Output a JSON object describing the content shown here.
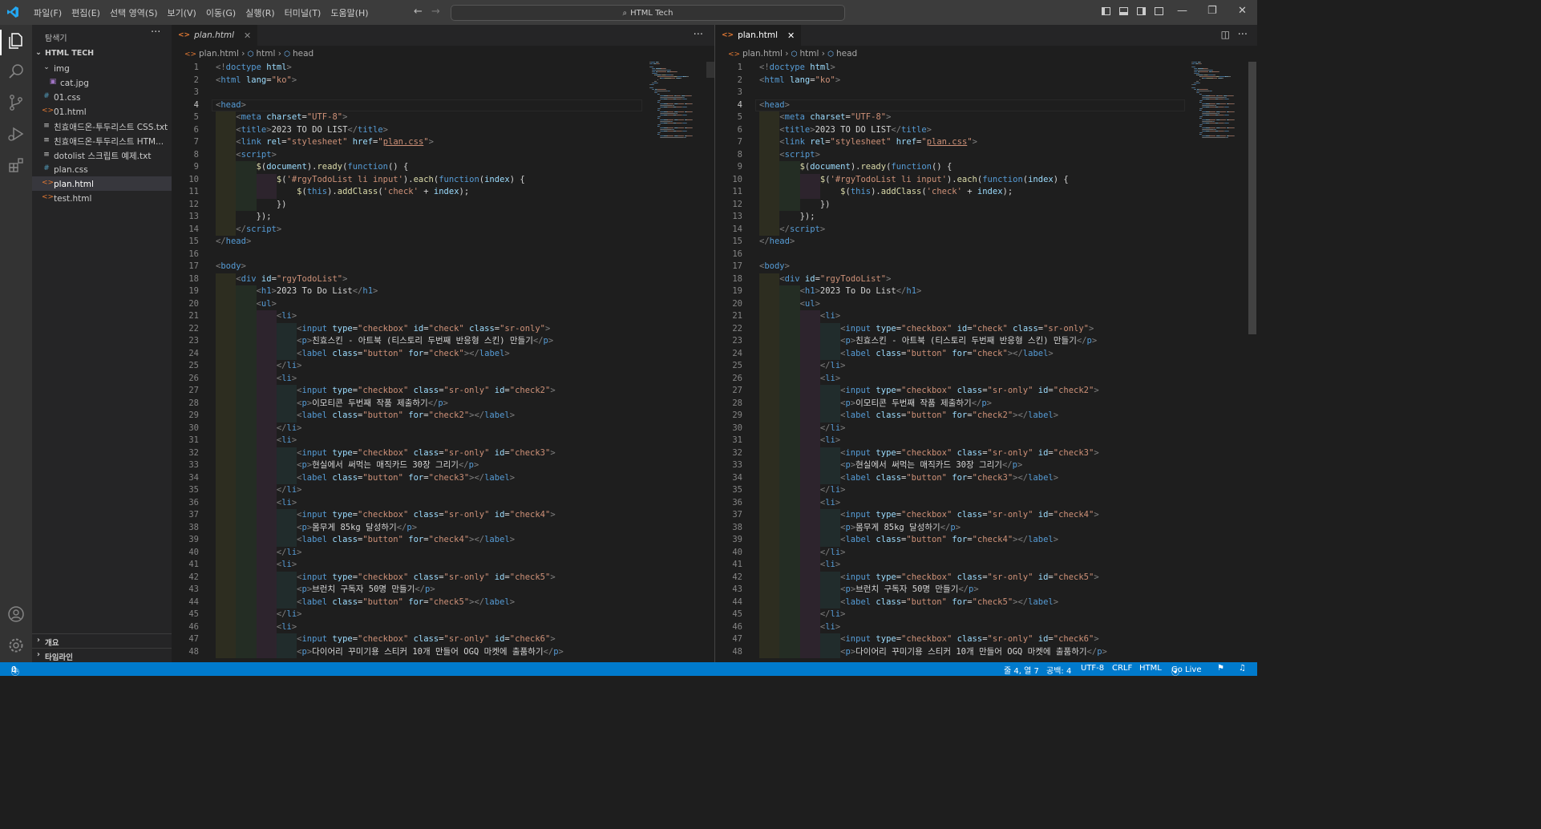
{
  "menus": [
    "파일(F)",
    "편집(E)",
    "선택 영역(S)",
    "보기(V)",
    "이동(G)",
    "실행(R)",
    "터미널(T)",
    "도움말(H)"
  ],
  "command_center": "HTML Tech",
  "sidebar": {
    "title": "탐색기",
    "root": "HTML TECH",
    "items": [
      {
        "label": "img",
        "icon": "chevron-down-icon"
      },
      {
        "label": "cat.jpg",
        "icon": "image-file-icon"
      },
      {
        "label": "01.css",
        "icon": "css-file-icon"
      },
      {
        "label": "01.html",
        "icon": "html-file-icon"
      },
      {
        "label": "친효애드온-투두리스트 CSS.txt",
        "icon": "text-file-icon"
      },
      {
        "label": "친효애드온-투두리스트 HTM...",
        "icon": "text-file-icon"
      },
      {
        "label": "dotolist 스크립트 예제.txt",
        "icon": "text-file-icon"
      },
      {
        "label": "plan.css",
        "icon": "css-file-icon"
      },
      {
        "label": "plan.html",
        "icon": "html-file-icon"
      },
      {
        "label": "test.html",
        "icon": "html-file-icon"
      }
    ],
    "outline": "개요",
    "timeline": "타임라인"
  },
  "editor": {
    "tab_label": "plan.html",
    "breadcrumb": [
      "plan.html",
      "html",
      "head"
    ],
    "current_line": 4
  },
  "code_lines": [
    [
      [
        "br",
        "<!"
      ],
      [
        "tg",
        "doctype"
      ],
      [
        "tx",
        " "
      ],
      [
        "at",
        "html"
      ],
      [
        "br",
        ">"
      ]
    ],
    [
      [
        "br",
        "<"
      ],
      [
        "tg",
        "html"
      ],
      [
        "tx",
        " "
      ],
      [
        "at",
        "lang"
      ],
      [
        "tx",
        "="
      ],
      [
        "st",
        "\"ko\""
      ],
      [
        "br",
        ">"
      ]
    ],
    [],
    [
      [
        "br",
        "<"
      ],
      [
        "tg",
        "head"
      ],
      [
        "br",
        ">"
      ]
    ],
    [
      [
        "tx",
        "    "
      ],
      [
        "br",
        "<"
      ],
      [
        "tg",
        "meta"
      ],
      [
        "tx",
        " "
      ],
      [
        "at",
        "charset"
      ],
      [
        "tx",
        "="
      ],
      [
        "st",
        "\"UTF-8\""
      ],
      [
        "br",
        ">"
      ]
    ],
    [
      [
        "tx",
        "    "
      ],
      [
        "br",
        "<"
      ],
      [
        "tg",
        "title"
      ],
      [
        "br",
        ">"
      ],
      [
        "tx",
        "2023 TO DO LIST"
      ],
      [
        "br",
        "</"
      ],
      [
        "tg",
        "title"
      ],
      [
        "br",
        ">"
      ]
    ],
    [
      [
        "tx",
        "    "
      ],
      [
        "br",
        "<"
      ],
      [
        "tg",
        "link"
      ],
      [
        "tx",
        " "
      ],
      [
        "at",
        "rel"
      ],
      [
        "tx",
        "="
      ],
      [
        "st",
        "\"stylesheet\""
      ],
      [
        "tx",
        " "
      ],
      [
        "at",
        "href"
      ],
      [
        "tx",
        "="
      ],
      [
        "st",
        "\""
      ],
      [
        "stu",
        "plan.css"
      ],
      [
        "st",
        "\""
      ],
      [
        "br",
        ">"
      ]
    ],
    [
      [
        "tx",
        "    "
      ],
      [
        "br",
        "<"
      ],
      [
        "tg",
        "script"
      ],
      [
        "br",
        ">"
      ]
    ],
    [
      [
        "tx",
        "        "
      ],
      [
        "fn",
        "$"
      ],
      [
        "tx",
        "("
      ],
      [
        "at",
        "document"
      ],
      [
        "tx",
        ")."
      ],
      [
        "fn",
        "ready"
      ],
      [
        "tx",
        "("
      ],
      [
        "kw",
        "function"
      ],
      [
        "tx",
        "() {"
      ]
    ],
    [
      [
        "tx",
        "            "
      ],
      [
        "fn",
        "$"
      ],
      [
        "tx",
        "("
      ],
      [
        "st",
        "'#rgyTodoList li input'"
      ],
      [
        "tx",
        ")."
      ],
      [
        "fn",
        "each"
      ],
      [
        "tx",
        "("
      ],
      [
        "kw",
        "function"
      ],
      [
        "tx",
        "("
      ],
      [
        "at",
        "index"
      ],
      [
        "tx",
        ") {"
      ]
    ],
    [
      [
        "tx",
        "                "
      ],
      [
        "fn",
        "$"
      ],
      [
        "tx",
        "("
      ],
      [
        "kw",
        "this"
      ],
      [
        "tx",
        ")."
      ],
      [
        "fn",
        "addClass"
      ],
      [
        "tx",
        "("
      ],
      [
        "st",
        "'check'"
      ],
      [
        "tx",
        " + "
      ],
      [
        "at",
        "index"
      ],
      [
        "tx",
        ");"
      ]
    ],
    [
      [
        "tx",
        "            })"
      ]
    ],
    [
      [
        "tx",
        "        });"
      ]
    ],
    [
      [
        "tx",
        "    "
      ],
      [
        "br",
        "</"
      ],
      [
        "tg",
        "script"
      ],
      [
        "br",
        ">"
      ]
    ],
    [
      [
        "br",
        "</"
      ],
      [
        "tg",
        "head"
      ],
      [
        "br",
        ">"
      ]
    ],
    [],
    [
      [
        "br",
        "<"
      ],
      [
        "tg",
        "body"
      ],
      [
        "br",
        ">"
      ]
    ],
    [
      [
        "tx",
        "    "
      ],
      [
        "br",
        "<"
      ],
      [
        "tg",
        "div"
      ],
      [
        "tx",
        " "
      ],
      [
        "at",
        "id"
      ],
      [
        "tx",
        "="
      ],
      [
        "st",
        "\"rgyTodoList\""
      ],
      [
        "br",
        ">"
      ]
    ],
    [
      [
        "tx",
        "        "
      ],
      [
        "br",
        "<"
      ],
      [
        "tg",
        "h1"
      ],
      [
        "br",
        ">"
      ],
      [
        "tx",
        "2023 To Do List"
      ],
      [
        "br",
        "</"
      ],
      [
        "tg",
        "h1"
      ],
      [
        "br",
        ">"
      ]
    ],
    [
      [
        "tx",
        "        "
      ],
      [
        "br",
        "<"
      ],
      [
        "tg",
        "ul"
      ],
      [
        "br",
        ">"
      ]
    ],
    [
      [
        "tx",
        "            "
      ],
      [
        "br",
        "<"
      ],
      [
        "tg",
        "li"
      ],
      [
        "br",
        ">"
      ]
    ],
    [
      [
        "tx",
        "                "
      ],
      [
        "br",
        "<"
      ],
      [
        "tg",
        "input"
      ],
      [
        "tx",
        " "
      ],
      [
        "at",
        "type"
      ],
      [
        "tx",
        "="
      ],
      [
        "st",
        "\"checkbox\""
      ],
      [
        "tx",
        " "
      ],
      [
        "at",
        "id"
      ],
      [
        "tx",
        "="
      ],
      [
        "st",
        "\"check\""
      ],
      [
        "tx",
        " "
      ],
      [
        "at",
        "class"
      ],
      [
        "tx",
        "="
      ],
      [
        "st",
        "\"sr-only\""
      ],
      [
        "br",
        ">"
      ]
    ],
    [
      [
        "tx",
        "                "
      ],
      [
        "br",
        "<"
      ],
      [
        "tg",
        "p"
      ],
      [
        "br",
        ">"
      ],
      [
        "tx",
        "친효스킨 - 아트북 (티스토리 두번째 반응형 스킨) 만들기"
      ],
      [
        "br",
        "</"
      ],
      [
        "tg",
        "p"
      ],
      [
        "br",
        ">"
      ]
    ],
    [
      [
        "tx",
        "                "
      ],
      [
        "br",
        "<"
      ],
      [
        "tg",
        "label"
      ],
      [
        "tx",
        " "
      ],
      [
        "at",
        "class"
      ],
      [
        "tx",
        "="
      ],
      [
        "st",
        "\"button\""
      ],
      [
        "tx",
        " "
      ],
      [
        "at",
        "for"
      ],
      [
        "tx",
        "="
      ],
      [
        "st",
        "\"check\""
      ],
      [
        "br",
        "></"
      ],
      [
        "tg",
        "label"
      ],
      [
        "br",
        ">"
      ]
    ],
    [
      [
        "tx",
        "            "
      ],
      [
        "br",
        "</"
      ],
      [
        "tg",
        "li"
      ],
      [
        "br",
        ">"
      ]
    ],
    [
      [
        "tx",
        "            "
      ],
      [
        "br",
        "<"
      ],
      [
        "tg",
        "li"
      ],
      [
        "br",
        ">"
      ]
    ],
    [
      [
        "tx",
        "                "
      ],
      [
        "br",
        "<"
      ],
      [
        "tg",
        "input"
      ],
      [
        "tx",
        " "
      ],
      [
        "at",
        "type"
      ],
      [
        "tx",
        "="
      ],
      [
        "st",
        "\"checkbox\""
      ],
      [
        "tx",
        " "
      ],
      [
        "at",
        "class"
      ],
      [
        "tx",
        "="
      ],
      [
        "st",
        "\"sr-only\""
      ],
      [
        "tx",
        " "
      ],
      [
        "at",
        "id"
      ],
      [
        "tx",
        "="
      ],
      [
        "st",
        "\"check2\""
      ],
      [
        "br",
        ">"
      ]
    ],
    [
      [
        "tx",
        "                "
      ],
      [
        "br",
        "<"
      ],
      [
        "tg",
        "p"
      ],
      [
        "br",
        ">"
      ],
      [
        "tx",
        "이모티콘 두번째 작품 제출하기"
      ],
      [
        "br",
        "</"
      ],
      [
        "tg",
        "p"
      ],
      [
        "br",
        ">"
      ]
    ],
    [
      [
        "tx",
        "                "
      ],
      [
        "br",
        "<"
      ],
      [
        "tg",
        "label"
      ],
      [
        "tx",
        " "
      ],
      [
        "at",
        "class"
      ],
      [
        "tx",
        "="
      ],
      [
        "st",
        "\"button\""
      ],
      [
        "tx",
        " "
      ],
      [
        "at",
        "for"
      ],
      [
        "tx",
        "="
      ],
      [
        "st",
        "\"check2\""
      ],
      [
        "br",
        "></"
      ],
      [
        "tg",
        "label"
      ],
      [
        "br",
        ">"
      ]
    ],
    [
      [
        "tx",
        "            "
      ],
      [
        "br",
        "</"
      ],
      [
        "tg",
        "li"
      ],
      [
        "br",
        ">"
      ]
    ],
    [
      [
        "tx",
        "            "
      ],
      [
        "br",
        "<"
      ],
      [
        "tg",
        "li"
      ],
      [
        "br",
        ">"
      ]
    ],
    [
      [
        "tx",
        "                "
      ],
      [
        "br",
        "<"
      ],
      [
        "tg",
        "input"
      ],
      [
        "tx",
        " "
      ],
      [
        "at",
        "type"
      ],
      [
        "tx",
        "="
      ],
      [
        "st",
        "\"checkbox\""
      ],
      [
        "tx",
        " "
      ],
      [
        "at",
        "class"
      ],
      [
        "tx",
        "="
      ],
      [
        "st",
        "\"sr-only\""
      ],
      [
        "tx",
        " "
      ],
      [
        "at",
        "id"
      ],
      [
        "tx",
        "="
      ],
      [
        "st",
        "\"check3\""
      ],
      [
        "br",
        ">"
      ]
    ],
    [
      [
        "tx",
        "                "
      ],
      [
        "br",
        "<"
      ],
      [
        "tg",
        "p"
      ],
      [
        "br",
        ">"
      ],
      [
        "tx",
        "현실에서 써먹는 매직카드 30장 그리기"
      ],
      [
        "br",
        "</"
      ],
      [
        "tg",
        "p"
      ],
      [
        "br",
        ">"
      ]
    ],
    [
      [
        "tx",
        "                "
      ],
      [
        "br",
        "<"
      ],
      [
        "tg",
        "label"
      ],
      [
        "tx",
        " "
      ],
      [
        "at",
        "class"
      ],
      [
        "tx",
        "="
      ],
      [
        "st",
        "\"button\""
      ],
      [
        "tx",
        " "
      ],
      [
        "at",
        "for"
      ],
      [
        "tx",
        "="
      ],
      [
        "st",
        "\"check3\""
      ],
      [
        "br",
        "></"
      ],
      [
        "tg",
        "label"
      ],
      [
        "br",
        ">"
      ]
    ],
    [
      [
        "tx",
        "            "
      ],
      [
        "br",
        "</"
      ],
      [
        "tg",
        "li"
      ],
      [
        "br",
        ">"
      ]
    ],
    [
      [
        "tx",
        "            "
      ],
      [
        "br",
        "<"
      ],
      [
        "tg",
        "li"
      ],
      [
        "br",
        ">"
      ]
    ],
    [
      [
        "tx",
        "                "
      ],
      [
        "br",
        "<"
      ],
      [
        "tg",
        "input"
      ],
      [
        "tx",
        " "
      ],
      [
        "at",
        "type"
      ],
      [
        "tx",
        "="
      ],
      [
        "st",
        "\"checkbox\""
      ],
      [
        "tx",
        " "
      ],
      [
        "at",
        "class"
      ],
      [
        "tx",
        "="
      ],
      [
        "st",
        "\"sr-only\""
      ],
      [
        "tx",
        " "
      ],
      [
        "at",
        "id"
      ],
      [
        "tx",
        "="
      ],
      [
        "st",
        "\"check4\""
      ],
      [
        "br",
        ">"
      ]
    ],
    [
      [
        "tx",
        "                "
      ],
      [
        "br",
        "<"
      ],
      [
        "tg",
        "p"
      ],
      [
        "br",
        ">"
      ],
      [
        "tx",
        "몸무게 85kg 달성하기"
      ],
      [
        "br",
        "</"
      ],
      [
        "tg",
        "p"
      ],
      [
        "br",
        ">"
      ]
    ],
    [
      [
        "tx",
        "                "
      ],
      [
        "br",
        "<"
      ],
      [
        "tg",
        "label"
      ],
      [
        "tx",
        " "
      ],
      [
        "at",
        "class"
      ],
      [
        "tx",
        "="
      ],
      [
        "st",
        "\"button\""
      ],
      [
        "tx",
        " "
      ],
      [
        "at",
        "for"
      ],
      [
        "tx",
        "="
      ],
      [
        "st",
        "\"check4\""
      ],
      [
        "br",
        "></"
      ],
      [
        "tg",
        "label"
      ],
      [
        "br",
        ">"
      ]
    ],
    [
      [
        "tx",
        "            "
      ],
      [
        "br",
        "</"
      ],
      [
        "tg",
        "li"
      ],
      [
        "br",
        ">"
      ]
    ],
    [
      [
        "tx",
        "            "
      ],
      [
        "br",
        "<"
      ],
      [
        "tg",
        "li"
      ],
      [
        "br",
        ">"
      ]
    ],
    [
      [
        "tx",
        "                "
      ],
      [
        "br",
        "<"
      ],
      [
        "tg",
        "input"
      ],
      [
        "tx",
        " "
      ],
      [
        "at",
        "type"
      ],
      [
        "tx",
        "="
      ],
      [
        "st",
        "\"checkbox\""
      ],
      [
        "tx",
        " "
      ],
      [
        "at",
        "class"
      ],
      [
        "tx",
        "="
      ],
      [
        "st",
        "\"sr-only\""
      ],
      [
        "tx",
        " "
      ],
      [
        "at",
        "id"
      ],
      [
        "tx",
        "="
      ],
      [
        "st",
        "\"check5\""
      ],
      [
        "br",
        ">"
      ]
    ],
    [
      [
        "tx",
        "                "
      ],
      [
        "br",
        "<"
      ],
      [
        "tg",
        "p"
      ],
      [
        "br",
        ">"
      ],
      [
        "tx",
        "브런치 구독자 50명 만들기"
      ],
      [
        "br",
        "</"
      ],
      [
        "tg",
        "p"
      ],
      [
        "br",
        ">"
      ]
    ],
    [
      [
        "tx",
        "                "
      ],
      [
        "br",
        "<"
      ],
      [
        "tg",
        "label"
      ],
      [
        "tx",
        " "
      ],
      [
        "at",
        "class"
      ],
      [
        "tx",
        "="
      ],
      [
        "st",
        "\"button\""
      ],
      [
        "tx",
        " "
      ],
      [
        "at",
        "for"
      ],
      [
        "tx",
        "="
      ],
      [
        "st",
        "\"check5\""
      ],
      [
        "br",
        "></"
      ],
      [
        "tg",
        "label"
      ],
      [
        "br",
        ">"
      ]
    ],
    [
      [
        "tx",
        "            "
      ],
      [
        "br",
        "</"
      ],
      [
        "tg",
        "li"
      ],
      [
        "br",
        ">"
      ]
    ],
    [
      [
        "tx",
        "            "
      ],
      [
        "br",
        "<"
      ],
      [
        "tg",
        "li"
      ],
      [
        "br",
        ">"
      ]
    ],
    [
      [
        "tx",
        "                "
      ],
      [
        "br",
        "<"
      ],
      [
        "tg",
        "input"
      ],
      [
        "tx",
        " "
      ],
      [
        "at",
        "type"
      ],
      [
        "tx",
        "="
      ],
      [
        "st",
        "\"checkbox\""
      ],
      [
        "tx",
        " "
      ],
      [
        "at",
        "class"
      ],
      [
        "tx",
        "="
      ],
      [
        "st",
        "\"sr-only\""
      ],
      [
        "tx",
        " "
      ],
      [
        "at",
        "id"
      ],
      [
        "tx",
        "="
      ],
      [
        "st",
        "\"check6\""
      ],
      [
        "br",
        ">"
      ]
    ],
    [
      [
        "tx",
        "                "
      ],
      [
        "br",
        "<"
      ],
      [
        "tg",
        "p"
      ],
      [
        "br",
        ">"
      ],
      [
        "tx",
        "다이어리 꾸미기용 스티커 10개 만들어 OGQ 마켓에 출품하기"
      ],
      [
        "br",
        "</"
      ],
      [
        "tg",
        "p"
      ],
      [
        "br",
        ">"
      ]
    ]
  ],
  "statusbar": {
    "problems": "0",
    "warnings": "0",
    "position": "줄 4, 열 7",
    "spaces": "공백: 4",
    "encoding": "UTF-8",
    "eol": "CRLF",
    "language": "HTML",
    "golive": "Go Live"
  },
  "colors": {
    "accent": "#007acc",
    "tag": "#569cd6",
    "attribute": "#9cdcfe",
    "string": "#ce9178",
    "function": "#dcdcaa"
  }
}
